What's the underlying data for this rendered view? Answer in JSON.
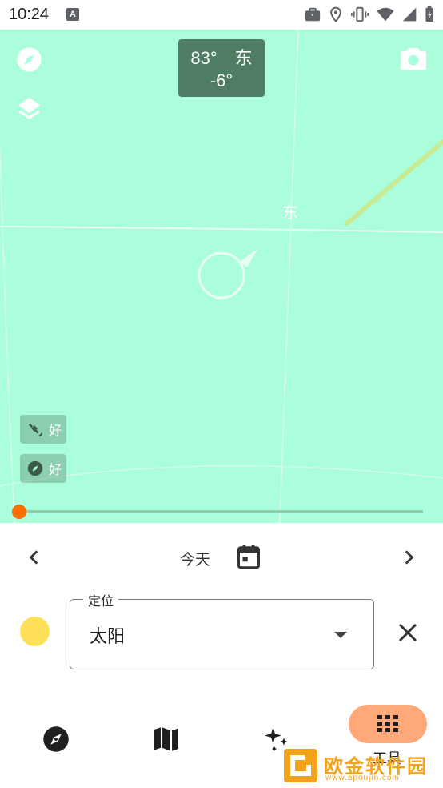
{
  "status_bar": {
    "time": "10:24",
    "notification_icon": "A"
  },
  "ar_view": {
    "azimuth": "83°",
    "direction": "东",
    "altitude": "-6°",
    "direction_marker": "东",
    "gps_quality": "好",
    "compass_quality": "好",
    "timeline_progress": 0.0
  },
  "date_nav": {
    "label": "今天"
  },
  "locate": {
    "legend": "定位",
    "value": "太阳",
    "sun_color": "#ffe05a"
  },
  "bottom_nav": {
    "active_label": "工具",
    "accent_color": "#ffa87a"
  },
  "watermark": {
    "text": "欧金软件园",
    "url": "www.apoujin.com"
  },
  "colors": {
    "sky": "#aafedb",
    "readout_bg": "#4f7d63",
    "timeline_knob": "#ff6d00"
  }
}
